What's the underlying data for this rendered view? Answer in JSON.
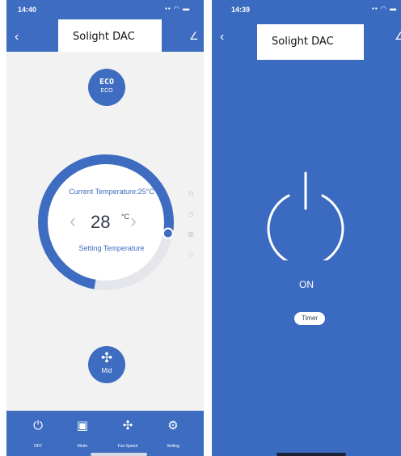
{
  "left_screen": {
    "status_time": "14:40",
    "title": "Solight DAC",
    "eco": {
      "label": "ECO",
      "sublabel": "ECO"
    },
    "dial": {
      "current_temperature": "Current Temperature:25°C",
      "set_temperature": "28",
      "unit": "°C",
      "setting_label": "Setting Temperature",
      "level": 0.75
    },
    "side_icons": [
      "lock-icon",
      "clock-icon",
      "grid-icon",
      "drop-icon"
    ],
    "fan": {
      "glyph": "✣",
      "label": "Mid"
    },
    "bottom_nav": [
      {
        "glyph": "⏻",
        "label": "OFF",
        "icon": "power-icon"
      },
      {
        "glyph": "▣",
        "label": "Mode",
        "icon": "mode-icon"
      },
      {
        "glyph": "✣",
        "label": "Fan Speed",
        "icon": "fan-icon"
      },
      {
        "glyph": "⚙",
        "label": "Setting",
        "icon": "gear-icon"
      }
    ]
  },
  "right_screen": {
    "status_time": "14:39",
    "title": "Solight DAC",
    "power_state": "ON",
    "timer_label": "Timer"
  },
  "colors": {
    "accent": "#3e6cc1",
    "right_background": "#3b6bc0",
    "left_background": "#f2f2f2",
    "dial_track": "#e4e6eb"
  }
}
